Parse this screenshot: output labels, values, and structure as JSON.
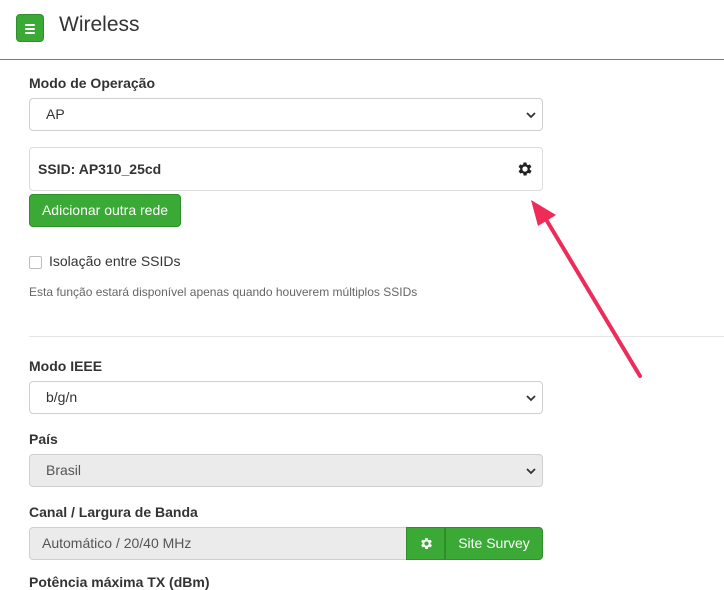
{
  "header": {
    "title": "Wireless",
    "menu_icon": "hamburger-icon"
  },
  "operation_mode": {
    "label": "Modo de Operação",
    "value": "AP"
  },
  "ssid": {
    "text": "SSID: AP310_25cd",
    "settings_icon": "gear-icon"
  },
  "add_network_button": "Adicionar outra rede",
  "isolation": {
    "label": "Isolação entre SSIDs",
    "checked": false,
    "help": "Esta função estará disponível apenas quando houverem múltiplos SSIDs"
  },
  "ieee_mode": {
    "label": "Modo IEEE",
    "value": "b/g/n"
  },
  "country": {
    "label": "País",
    "value": "Brasil"
  },
  "channel": {
    "label": "Canal / Largura de Banda",
    "value": "Automático / 20/40 MHz",
    "site_survey_button": "Site Survey"
  },
  "tx_power": {
    "label": "Potência máxima TX (dBm)"
  },
  "colors": {
    "accent": "#3aa935",
    "annotation_arrow": "#ef2b5a"
  }
}
